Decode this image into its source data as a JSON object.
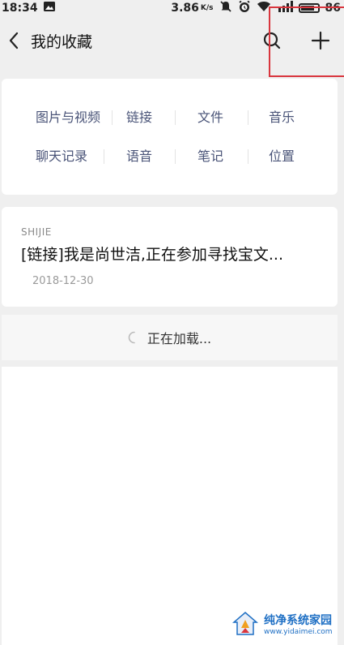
{
  "status_bar": {
    "time": "18:34",
    "speed": "3.86",
    "speed_unit": "K/s",
    "battery": "86"
  },
  "header": {
    "title": "我的收藏"
  },
  "categories": {
    "row1": [
      "图片与视频",
      "链接",
      "文件",
      "音乐"
    ],
    "row2": [
      "聊天记录",
      "语音",
      "笔记",
      "位置"
    ]
  },
  "favorites": [
    {
      "source": "SHIJIE",
      "title": "[链接]我是尚世洁,正在参加寻找宝文...",
      "date": "2018-12-30"
    }
  ],
  "loading": {
    "text": "正在加载..."
  },
  "watermark": {
    "title": "纯净系统家园",
    "url": "www.yidaimei.com"
  },
  "colors": {
    "highlight": "#d9363e",
    "category_text": "#4a5478",
    "watermark": "#1e6fc4"
  }
}
